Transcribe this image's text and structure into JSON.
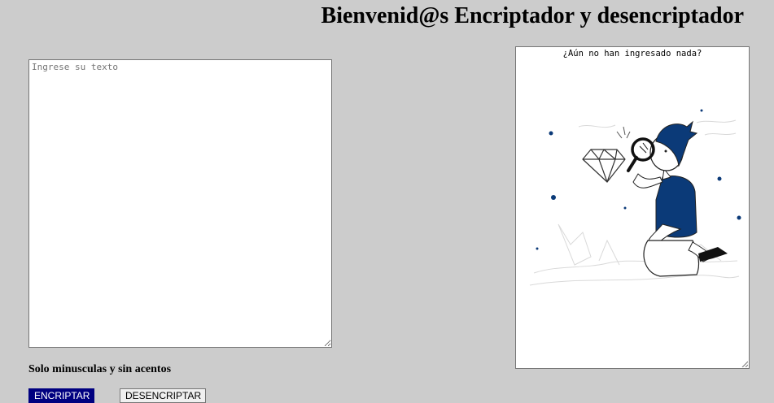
{
  "header": {
    "title": "Bienvenid@s Encriptador y desencriptador"
  },
  "input": {
    "placeholder": "Ingrese su texto",
    "value": ""
  },
  "hint": {
    "text": "Solo minusculas y sin acentos"
  },
  "buttons": {
    "encrypt_label": "ENCRIPTAR",
    "decrypt_label": "DESENCRIPTAR"
  },
  "output": {
    "message": "¿Aún no han ingresado nada?",
    "illustration_icon": "person-magnifying-glass-diamond-illustration"
  },
  "colors": {
    "background": "#cccccc",
    "accent": "#000080",
    "illustration_blue": "#0b3a78"
  }
}
